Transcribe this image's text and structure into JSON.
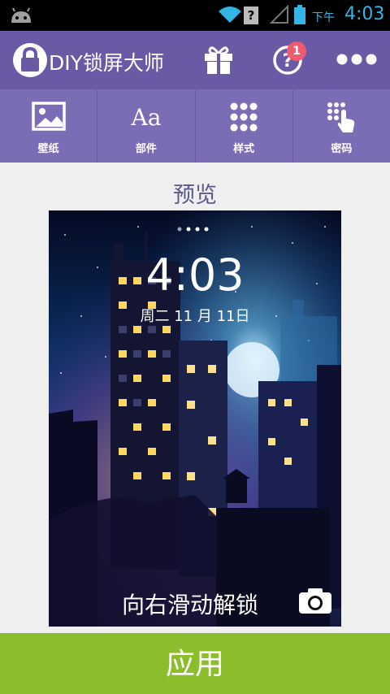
{
  "status_bar": {
    "ampm": "下午",
    "time": "4:03",
    "sim_indicator": "?",
    "accent_color": "#33b5e5"
  },
  "app_bar": {
    "title": "DIY锁屏大师",
    "help_badge_count": "1",
    "icons": [
      "lock-logo-icon",
      "gift-icon",
      "help-icon",
      "more-icon"
    ],
    "color": "#6a5aa6"
  },
  "tabs": [
    {
      "label": "壁纸",
      "icon": "wallpaper-icon"
    },
    {
      "label": "部件",
      "icon": "font-icon"
    },
    {
      "label": "样式",
      "icon": "grid-dots-icon"
    },
    {
      "label": "密码",
      "icon": "keypad-touch-icon"
    }
  ],
  "preview": {
    "title": "预览",
    "lock_time": "4:03",
    "lock_date": "周二 11 月 11日",
    "unlock_hint": "向右滑动解锁"
  },
  "apply_button": {
    "label": "应用",
    "color": "#8bbd2c"
  }
}
